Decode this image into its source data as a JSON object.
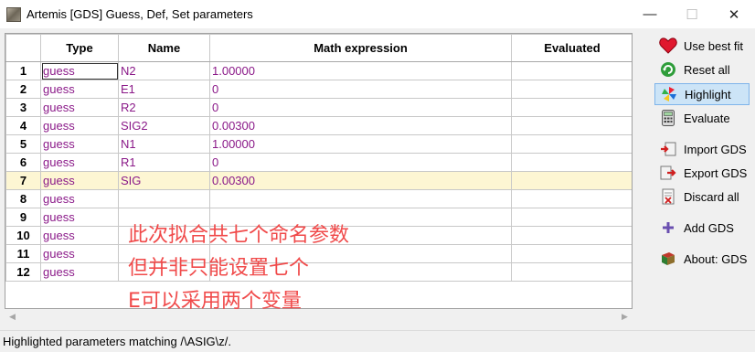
{
  "window": {
    "title": "Artemis [GDS] Guess, Def, Set parameters",
    "minimize_icon": "minimize-icon",
    "maximize_icon": "maximize-icon",
    "close_icon": "close-icon"
  },
  "grid": {
    "columns": [
      "",
      "Type",
      "Name",
      "Math expression",
      "Evaluated"
    ],
    "active_row": 1,
    "highlighted_row": 7,
    "rows": [
      {
        "num": "1",
        "type": "guess",
        "name": "N2",
        "expr": "1.00000",
        "evaluated": ""
      },
      {
        "num": "2",
        "type": "guess",
        "name": "E1",
        "expr": "0",
        "evaluated": ""
      },
      {
        "num": "3",
        "type": "guess",
        "name": "R2",
        "expr": "0",
        "evaluated": ""
      },
      {
        "num": "4",
        "type": "guess",
        "name": "SIG2",
        "expr": "0.00300",
        "evaluated": ""
      },
      {
        "num": "5",
        "type": "guess",
        "name": "N1",
        "expr": "1.00000",
        "evaluated": ""
      },
      {
        "num": "6",
        "type": "guess",
        "name": "R1",
        "expr": "0",
        "evaluated": ""
      },
      {
        "num": "7",
        "type": "guess",
        "name": "SIG",
        "expr": "0.00300",
        "evaluated": ""
      },
      {
        "num": "8",
        "type": "guess",
        "name": "",
        "expr": "",
        "evaluated": ""
      },
      {
        "num": "9",
        "type": "guess",
        "name": "",
        "expr": "",
        "evaluated": ""
      },
      {
        "num": "10",
        "type": "guess",
        "name": "",
        "expr": "",
        "evaluated": ""
      },
      {
        "num": "11",
        "type": "guess",
        "name": "",
        "expr": "",
        "evaluated": ""
      },
      {
        "num": "12",
        "type": "guess",
        "name": "",
        "expr": "",
        "evaluated": ""
      }
    ]
  },
  "annotation": {
    "line1": "此次拟合共七个命名参数",
    "line2": "但并非只能设置七个",
    "line3": "E可以采用两个变量"
  },
  "side_buttons": [
    {
      "label": "Use best fit",
      "icon": "heart-icon"
    },
    {
      "label": "Reset all",
      "icon": "recycle-icon"
    },
    {
      "label": "Highlight",
      "icon": "pinwheel-icon",
      "selected": true
    },
    {
      "label": "Evaluate",
      "icon": "calculator-icon"
    },
    {
      "label": "Import GDS",
      "icon": "import-icon"
    },
    {
      "label": "Export GDS",
      "icon": "export-icon"
    },
    {
      "label": "Discard all",
      "icon": "discard-icon"
    },
    {
      "label": "Add GDS",
      "icon": "add-icon"
    },
    {
      "label": "About: GDS",
      "icon": "book-icon"
    }
  ],
  "status": {
    "text": "Highlighted parameters matching /\\ASIG\\z/."
  },
  "colors": {
    "type_text": "#8b1a89",
    "highlight_row": "#fdf6d3",
    "annotation": "#f04a4a",
    "selected_button": "#cce4f7"
  }
}
